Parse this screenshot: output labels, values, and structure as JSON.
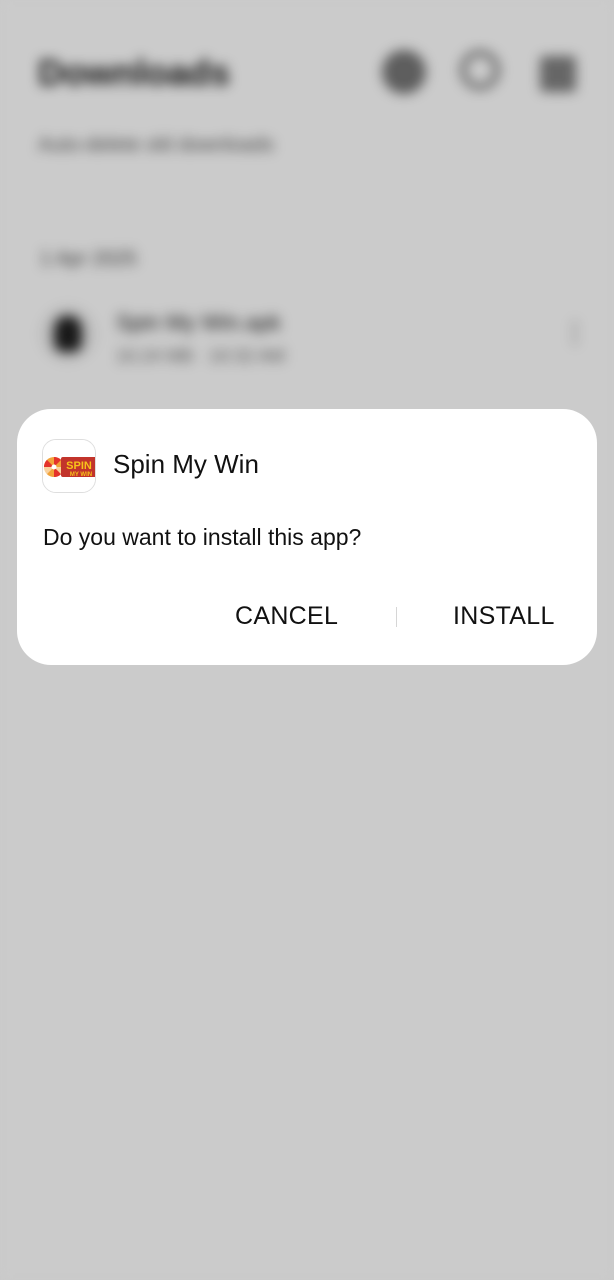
{
  "background_app": {
    "title": "Downloads",
    "subtitle": "Auto-delete old downloads",
    "date_header": "1 Apr 2025",
    "file": {
      "name": "Spin My Win.apk",
      "meta": "10.24 MB · 10:32 AM"
    }
  },
  "dialog": {
    "app_name": "Spin My Win",
    "message": "Do you want to install this app?",
    "cancel_label": "CANCEL",
    "install_label": "INSTALL",
    "icon": {
      "name": "spin-my-win-logo-icon",
      "wordmark_top": "SPIN",
      "wordmark_bottom": "MY WIN",
      "colors": {
        "wheel_red": "#e4322b",
        "wheel_orange": "#f2a33a",
        "wordmark": "#f7c21a"
      }
    }
  }
}
